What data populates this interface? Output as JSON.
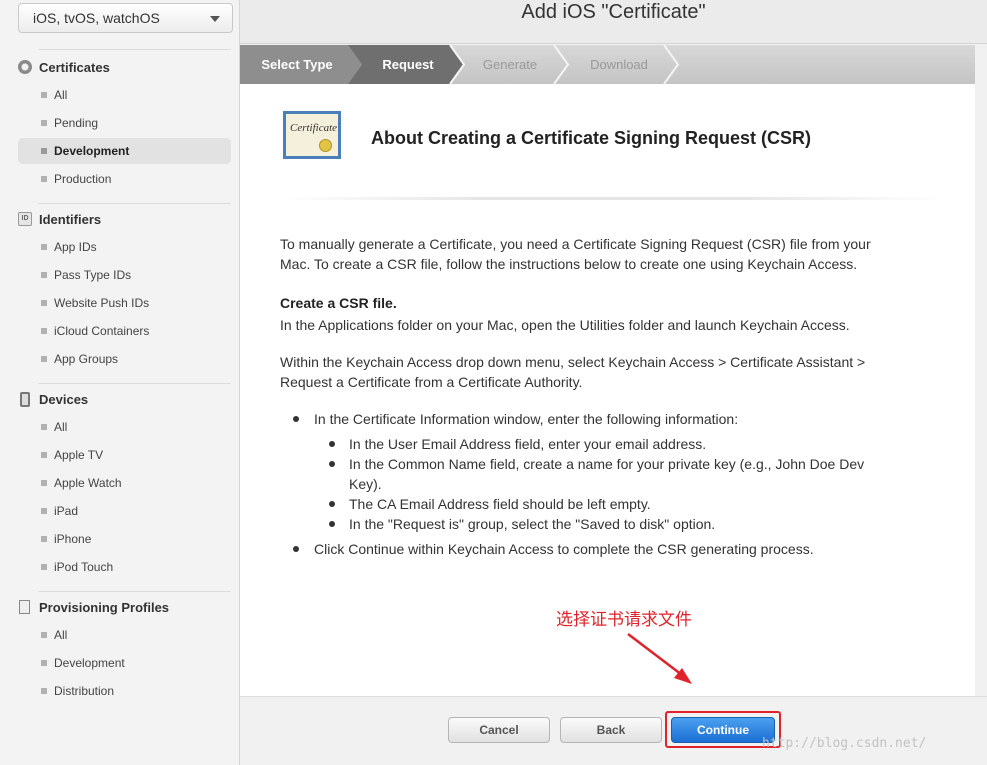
{
  "platform_select": {
    "value": "iOS, tvOS, watchOS"
  },
  "sidebar": {
    "certificates": {
      "header": "Certificates",
      "items": [
        "All",
        "Pending",
        "Development",
        "Production"
      ]
    },
    "identifiers": {
      "header": "Identifiers",
      "icon_text": "ID",
      "items": [
        "App IDs",
        "Pass Type IDs",
        "Website Push IDs",
        "iCloud Containers",
        "App Groups"
      ]
    },
    "devices": {
      "header": "Devices",
      "items": [
        "All",
        "Apple TV",
        "Apple Watch",
        "iPad",
        "iPhone",
        "iPod Touch"
      ]
    },
    "provisioning": {
      "header": "Provisioning Profiles",
      "items": [
        "All",
        "Development",
        "Distribution"
      ]
    },
    "active_item": "Development"
  },
  "window": {
    "title": "Add iOS \"Certificate\""
  },
  "steps": [
    "Select Type",
    "Request",
    "Generate",
    "Download"
  ],
  "content": {
    "cert_icon_text": "Certificate",
    "title": "About Creating a Certificate Signing Request (CSR)",
    "intro_1": "To manually generate a Certificate, you need a Certificate Signing Request (CSR) file from your",
    "intro_2": "Mac. To create a CSR file, follow the instructions below to create one using Keychain Access.",
    "create_heading": "Create a CSR file.",
    "create_text": "In the Applications folder on your Mac, open the Utilities folder and launch Keychain Access.",
    "menu_1": "Within the Keychain Access drop down menu, select Keychain Access > Certificate Assistant >",
    "menu_2": "Request a Certificate from a Certificate Authority.",
    "bullet_1": "In the Certificate Information window, enter the following information:",
    "sub_1": "In the User Email Address field, enter your email address.",
    "sub_2a": "In the Common Name field, create a name for your private key (e.g., John Doe Dev",
    "sub_2b": "Key).",
    "sub_3": "The CA Email Address field should be left empty.",
    "sub_4": "In the \"Request is\" group, select the \"Saved to disk\" option.",
    "bullet_2": "Click Continue within Keychain Access to complete the CSR generating process."
  },
  "annotation": {
    "text": "选择证书请求文件",
    "color": "#e0222a"
  },
  "footer": {
    "cancel": "Cancel",
    "back": "Back",
    "continue": "Continue"
  },
  "watermark": "http://blog.csdn.net/"
}
